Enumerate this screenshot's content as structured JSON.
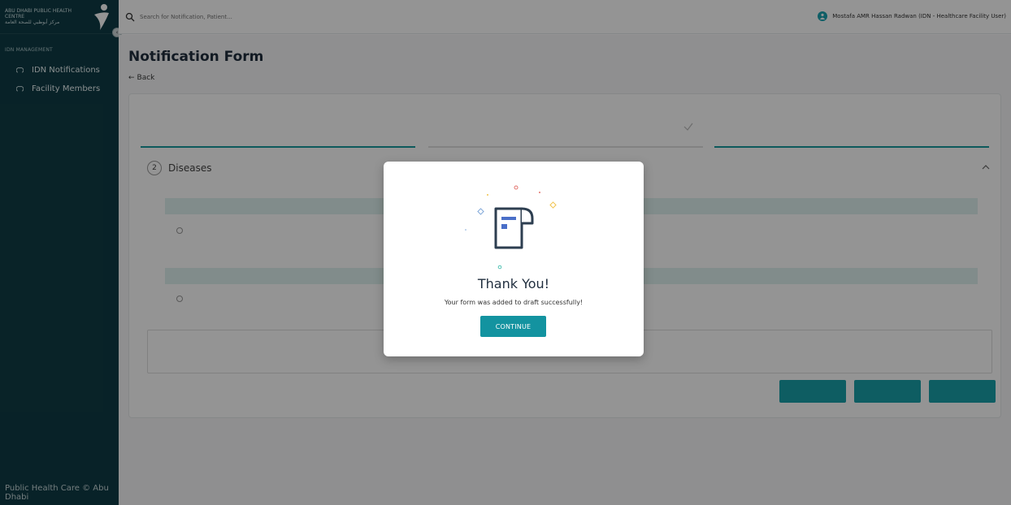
{
  "sidebar": {
    "logo_text_en": "ABU DHABI PUBLIC HEALTH CENTRE",
    "logo_text_ar": "مركز أبوظبي للصحة العامة",
    "section_title": "IDN MANAGEMENT",
    "items": [
      {
        "label": "IDN Notifications",
        "icon": "cloud-icon"
      },
      {
        "label": "Facility Members",
        "icon": "cloud-icon"
      }
    ],
    "footer": "Public Health Care © Abu Dhabi"
  },
  "topbar": {
    "search_placeholder": "Search for Notification, Patient...",
    "user_name": "Mostafa AMR Hassan Radwan (IDN - Healthcare Facility User)"
  },
  "main": {
    "title": "Notification Form",
    "back_label": "Back",
    "step_number": "2",
    "step_title": "Diseases"
  },
  "modal": {
    "title": "Thank You!",
    "message": "Your form was added to draft successfully!",
    "continue_label": "CONTINUE"
  },
  "colors": {
    "sidebar_bg": "#0f3c45",
    "accent": "#1393a0",
    "overlay": "rgba(0,0,0,0.42)"
  }
}
